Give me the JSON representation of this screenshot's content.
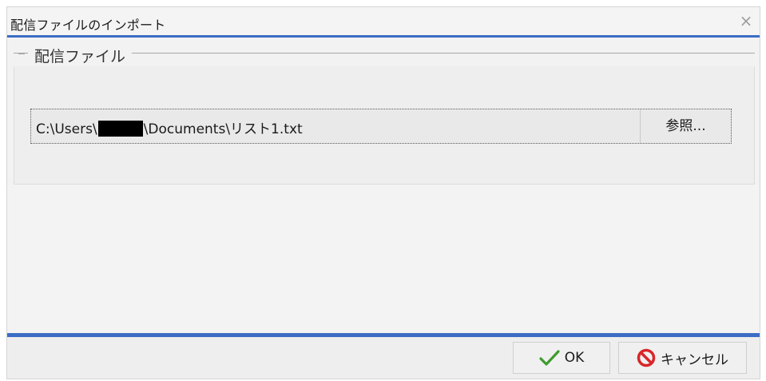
{
  "dialog": {
    "title": "配信ファイルのインポート",
    "close_glyph": "×"
  },
  "group": {
    "legend": "配信ファイル"
  },
  "path": {
    "prefix": "C:\\Users\\",
    "suffix": "\\Documents\\リスト1.txt",
    "browse_label": "参照..."
  },
  "footer": {
    "ok_label": "OK",
    "cancel_label": "キャンセル"
  },
  "icons": {
    "ok": "checkmark-icon",
    "cancel": "no-entry-icon"
  },
  "colors": {
    "accent": "#3b6dc4",
    "ok_check": "#3f9b2e",
    "cancel_red": "#d9252a"
  }
}
